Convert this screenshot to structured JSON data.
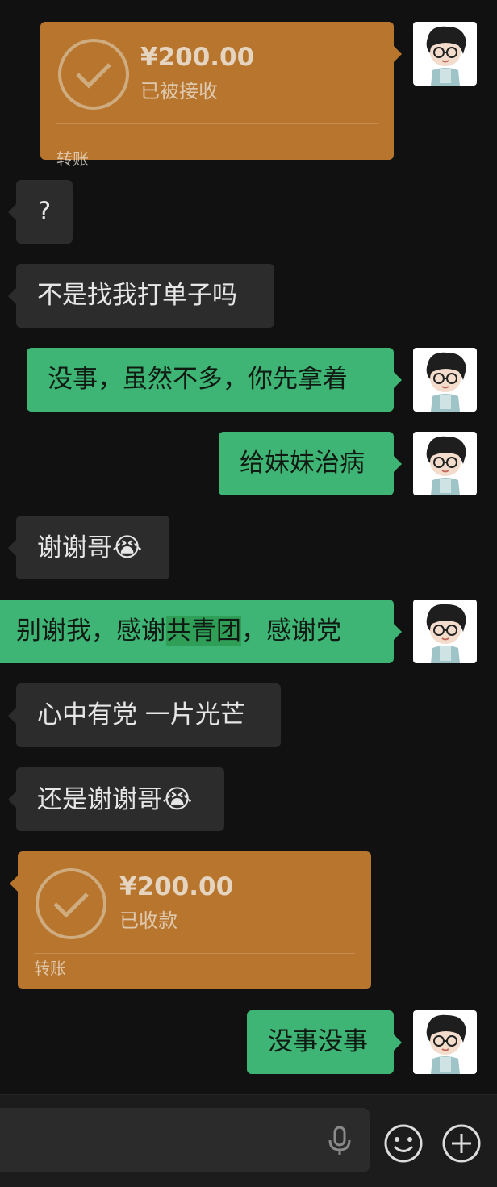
{
  "messages": {
    "transfer_sent": {
      "amount": "¥200.00",
      "status": "已被接收",
      "label": "转账"
    },
    "q": "?",
    "m1": "不是找我打单子吗",
    "m2": "没事，虽然不多，你先拿着",
    "m3": "给妹妹治病",
    "m4": "谢谢哥",
    "m5_a": "别谢我，感谢",
    "m5_hl": "共青团",
    "m5_b": "，感谢党",
    "m6": "心中有党 一片光芒",
    "m7": "还是谢谢哥",
    "transfer_recv": {
      "amount": "¥200.00",
      "status": "已收款",
      "label": "转账"
    },
    "m8": "没事没事"
  },
  "emoji": "😭",
  "icons": [
    "checkmark-circle-icon",
    "avatar",
    "microphone-icon",
    "emoji-icon",
    "plus-icon"
  ],
  "colors": {
    "background": "#111111",
    "left_bubble": "#2c2c2c",
    "right_bubble": "#3eb575",
    "transfer": "#b7752e",
    "highlight": "#2f9f58"
  }
}
